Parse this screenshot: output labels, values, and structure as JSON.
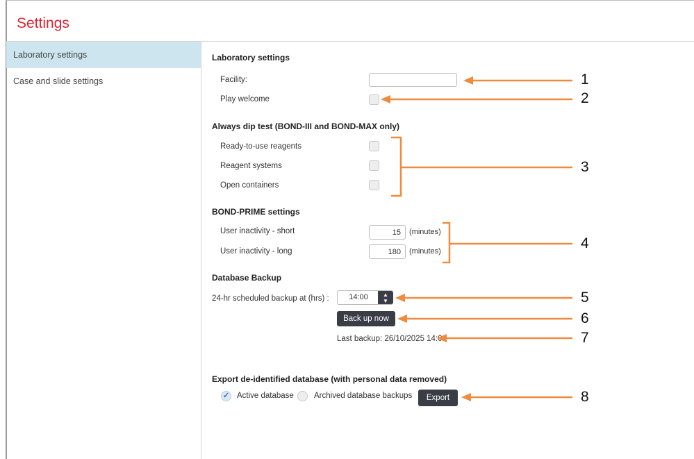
{
  "window": {
    "title": "Settings"
  },
  "sidebar": {
    "items": [
      {
        "label": "Laboratory settings",
        "active": true
      },
      {
        "label": "Case and slide settings",
        "active": false
      }
    ]
  },
  "lab": {
    "heading": "Laboratory settings",
    "facility_label": "Facility:",
    "facility_value": "",
    "play_welcome_label": "Play welcome"
  },
  "dip": {
    "heading": "Always dip test (BOND-III and BOND-MAX only)",
    "items": [
      "Ready-to-use reagents",
      "Reagent systems",
      "Open containers"
    ]
  },
  "prime": {
    "heading": "BOND-PRIME settings",
    "short_label": "User inactivity - short",
    "short_value": "15",
    "long_label": "User inactivity - long",
    "long_value": "180",
    "unit": "(minutes)"
  },
  "backup": {
    "heading": "Database Backup",
    "schedule_label": "24-hr scheduled backup at (hrs) :",
    "schedule_value": "14:00",
    "backup_button": "Back up now",
    "last_backup": "Last backup: 26/10/2025 14:00"
  },
  "export": {
    "heading": "Export de-identified database (with personal data removed)",
    "active_label": "Active database",
    "archived_label": "Archived database backups",
    "selected": "Active database",
    "export_button": "Export"
  },
  "callouts": [
    "1",
    "2",
    "3",
    "4",
    "5",
    "6",
    "7",
    "8"
  ],
  "colors": {
    "title": "#e0242e",
    "sidebar_active": "#cde5ef",
    "arrow": "#f08a3c",
    "button": "#3a3d46"
  },
  "icons": {
    "check": "check-icon",
    "spinner": "spinner-arrows-icon"
  }
}
